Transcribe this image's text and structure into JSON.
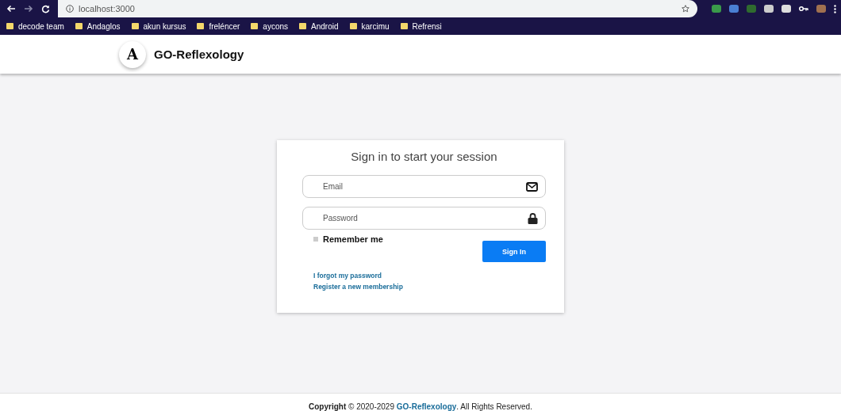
{
  "browser": {
    "url": "localhost:3000",
    "bookmarks": [
      "decode team",
      "Andaglos",
      "akun kursus",
      "freléncer",
      "aycons",
      "Android",
      "karcimu",
      "Refrensi"
    ]
  },
  "header": {
    "logo_letter": "A",
    "title": "GO-Reflexology"
  },
  "login": {
    "title": "Sign in to start your session",
    "email_placeholder": "Email",
    "password_placeholder": "Password",
    "remember": {
      "label": "Remember me",
      "checked": false
    },
    "button": "Sign In",
    "links": [
      "I forgot my password",
      "Register a new membership"
    ]
  },
  "footer": {
    "before": "**Copyright** © 2020-2029 ",
    "link": "GO-Reflexology",
    "after": ". All Rights Reserved."
  }
}
